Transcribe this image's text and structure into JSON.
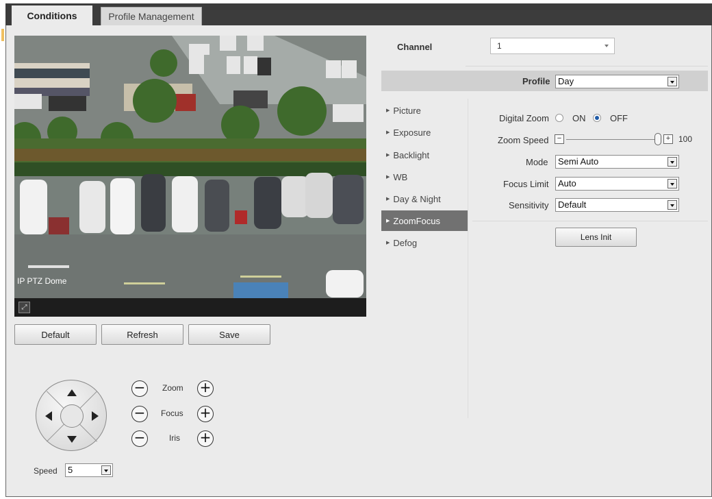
{
  "tabs": {
    "conditions": "Conditions",
    "profile_management": "Profile Management"
  },
  "video": {
    "overlay_text": "IP PTZ Dome",
    "fullscreen_icon": "fullscreen-icon"
  },
  "buttons": {
    "default": "Default",
    "refresh": "Refresh",
    "save": "Save",
    "lens_init": "Lens Init"
  },
  "ptz": {
    "zoom_label": "Zoom",
    "focus_label": "Focus",
    "iris_label": "Iris",
    "minus": "−",
    "plus": "+",
    "speed_label": "Speed",
    "speed_value": "5"
  },
  "channel": {
    "label": "Channel",
    "value": "1"
  },
  "profile": {
    "label": "Profile",
    "value": "Day"
  },
  "menu": {
    "items": [
      {
        "label": "Picture"
      },
      {
        "label": "Exposure"
      },
      {
        "label": "Backlight"
      },
      {
        "label": "WB"
      },
      {
        "label": "Day & Night"
      },
      {
        "label": "ZoomFocus"
      },
      {
        "label": "Defog"
      }
    ],
    "active": "ZoomFocus"
  },
  "zoomfocus": {
    "digital_zoom_label": "Digital Zoom",
    "on_label": "ON",
    "off_label": "OFF",
    "digital_zoom_value": "OFF",
    "zoom_speed_label": "Zoom Speed",
    "zoom_speed_value": "100",
    "zoom_speed_level": 100,
    "mode_label": "Mode",
    "mode_value": "Semi Auto",
    "focus_limit_label": "Focus Limit",
    "focus_limit_value": "Auto",
    "sensitivity_label": "Sensitivity",
    "sensitivity_value": "Default"
  }
}
